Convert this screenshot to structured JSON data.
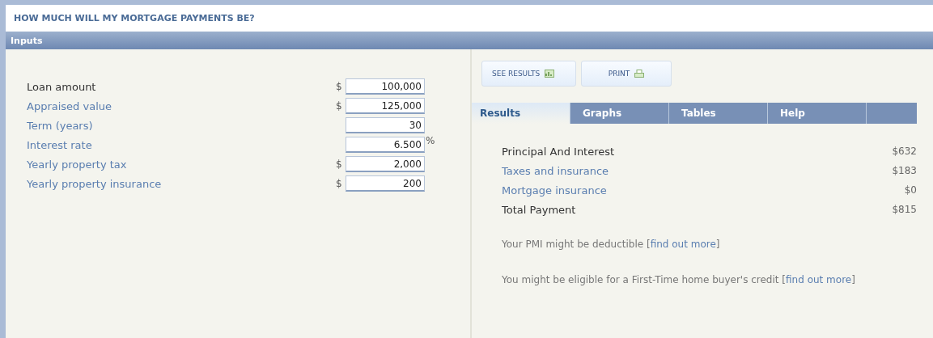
{
  "title": "HOW MUCH WILL MY MORTGAGE PAYMENTS BE?",
  "section": "Inputs",
  "inputs": [
    {
      "label": "Loan amount",
      "kind": "plain",
      "prefix": "$",
      "value": "100,000"
    },
    {
      "label": "Appraised value",
      "kind": "link",
      "prefix": "$",
      "value": "125,000"
    },
    {
      "label": "Term (years)",
      "kind": "link",
      "value": "30"
    },
    {
      "label": "Interest rate",
      "kind": "link",
      "value": "6.500",
      "suffix": "%"
    },
    {
      "label": "Yearly property tax",
      "kind": "link",
      "prefix": "$",
      "value": "2,000"
    },
    {
      "label": "Yearly property insurance",
      "kind": "link",
      "prefix": "$",
      "value": "200"
    }
  ],
  "buttons": [
    {
      "label": "SEE RESULTS",
      "kind": "chart"
    },
    {
      "label": "PRINT",
      "kind": "printer"
    }
  ],
  "tabs": [
    {
      "label": "Results",
      "selected": true
    },
    {
      "label": "Graphs",
      "selected": false
    },
    {
      "label": "Tables",
      "selected": false
    },
    {
      "label": "Help",
      "selected": false
    }
  ],
  "results": [
    {
      "label": "Principal And Interest",
      "kind": "plain",
      "value": "$632"
    },
    {
      "label": "Taxes and insurance",
      "kind": "link",
      "value": "$183"
    },
    {
      "label": "Mortgage insurance",
      "kind": "link",
      "value": "$0"
    },
    {
      "label": "Total Payment",
      "kind": "plain",
      "value": "$815"
    }
  ],
  "notes": [
    {
      "text": "Your PMI might be deductible [",
      "link": "find out more",
      "after": "]"
    },
    {
      "text": "You might be eligible for a First-Time home buyer's credit [",
      "link": "find out more",
      "after": "]"
    }
  ]
}
